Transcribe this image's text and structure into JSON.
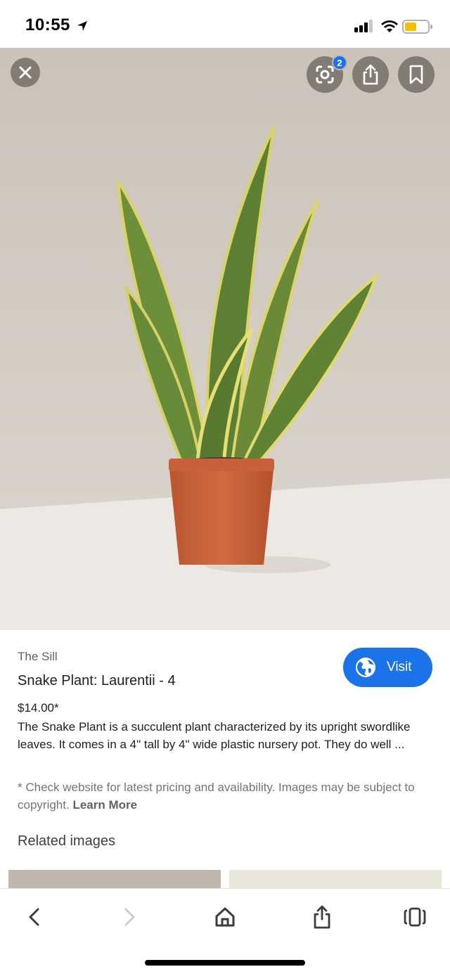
{
  "status_bar": {
    "time": "10:55",
    "icons": [
      "location-arrow-icon",
      "cellular-signal-icon",
      "wifi-icon",
      "battery-icon"
    ],
    "battery_color": "#f2c200"
  },
  "image_overlay": {
    "close_icon": "close-icon",
    "lens_icon": "lens-icon",
    "lens_badge": "2",
    "share_icon": "share-icon",
    "save_icon": "bookmark-icon"
  },
  "result": {
    "source": "The Sill",
    "title": "Snake Plant: Laurentii - 4",
    "visit_label": "Visit",
    "price": "$14.00*",
    "description": "The Snake Plant is a succulent plant characterized by its upright swordlike leaves. It comes in a 4\" tall by 4\" wide plastic nursery pot. They do well ...",
    "disclaimer": "* Check website for latest pricing and availability. Images may be subject to copyright.",
    "learn_more": "Learn More"
  },
  "related": {
    "title": "Related images"
  },
  "toolbar": {
    "icons": [
      "back-icon",
      "forward-icon",
      "home-icon",
      "share-icon",
      "tabs-icon"
    ]
  },
  "colors": {
    "accent": "#1a73e8",
    "background_wall": "#d7d0c8",
    "table": "#ece8e3",
    "pot": "#c8623a"
  }
}
